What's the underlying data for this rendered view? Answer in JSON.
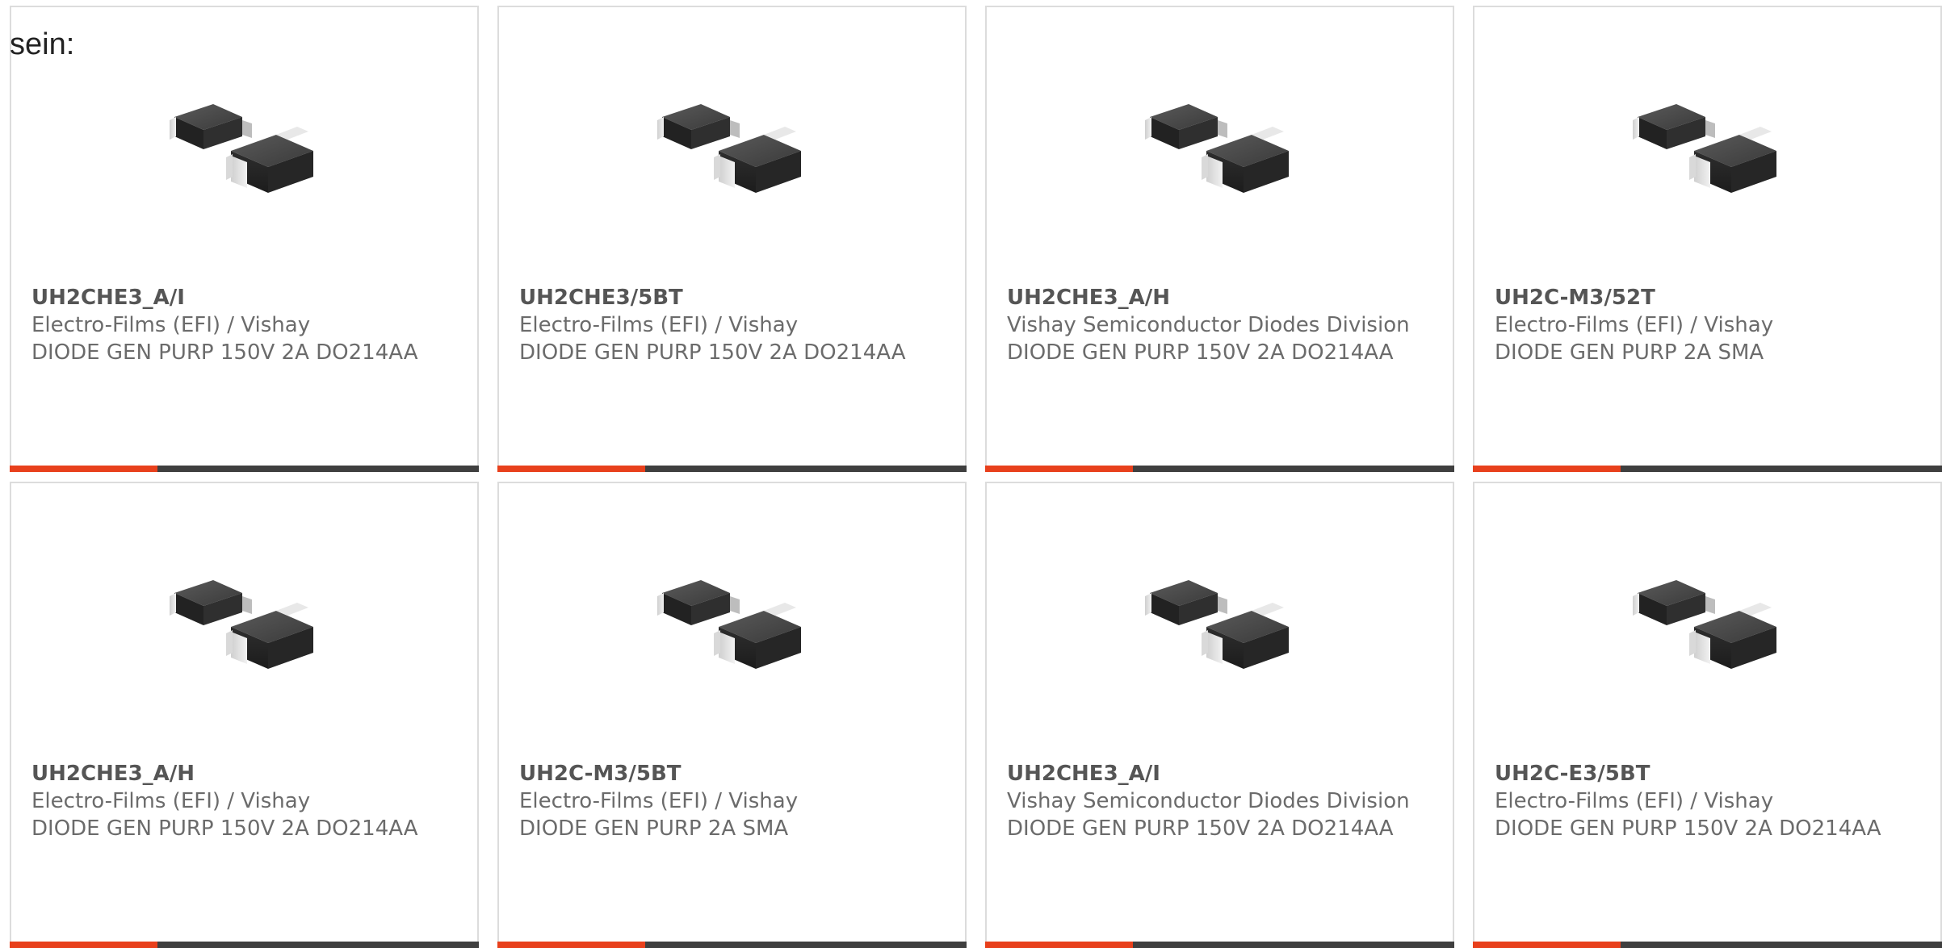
{
  "intro_text": "sein:",
  "colors": {
    "accent": "#e8401c",
    "bar": "#3f3f3f",
    "border": "#dcdcdc",
    "text": "#6b6b6b"
  },
  "product_icon": "smd-diode-package-image",
  "products": [
    {
      "part_number": "UH2CHE3_A/I",
      "manufacturer": "Electro-Films (EFI) / Vishay",
      "description": "DIODE GEN PURP 150V 2A DO214AA"
    },
    {
      "part_number": "UH2CHE3/5BT",
      "manufacturer": "Electro-Films (EFI) / Vishay",
      "description": "DIODE GEN PURP 150V 2A DO214AA"
    },
    {
      "part_number": "UH2CHE3_A/H",
      "manufacturer": "Vishay Semiconductor Diodes Division",
      "description": "DIODE GEN PURP 150V 2A DO214AA"
    },
    {
      "part_number": "UH2C-M3/52T",
      "manufacturer": "Electro-Films (EFI) / Vishay",
      "description": "DIODE GEN PURP 2A SMA"
    },
    {
      "part_number": "UH2CHE3_A/H",
      "manufacturer": "Electro-Films (EFI) / Vishay",
      "description": "DIODE GEN PURP 150V 2A DO214AA"
    },
    {
      "part_number": "UH2C-M3/5BT",
      "manufacturer": "Electro-Films (EFI) / Vishay",
      "description": "DIODE GEN PURP 2A SMA"
    },
    {
      "part_number": "UH2CHE3_A/I",
      "manufacturer": "Vishay Semiconductor Diodes Division",
      "description": "DIODE GEN PURP 150V 2A DO214AA"
    },
    {
      "part_number": "UH2C-E3/5BT",
      "manufacturer": "Electro-Films (EFI) / Vishay",
      "description": "DIODE GEN PURP 150V 2A DO214AA"
    }
  ]
}
